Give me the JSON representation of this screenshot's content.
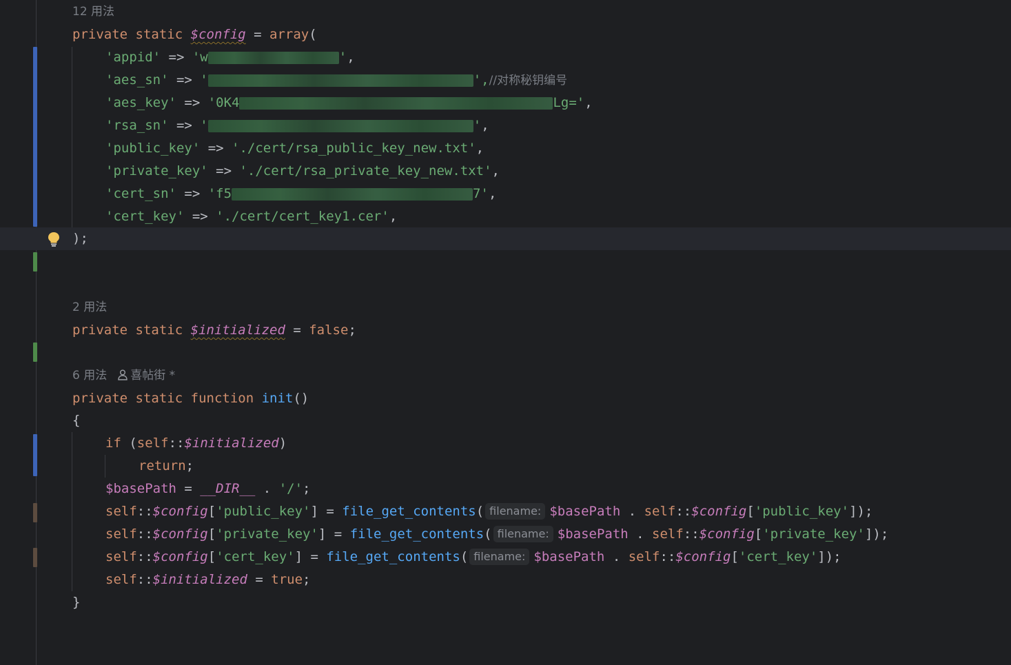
{
  "editor": {
    "usage_hints": {
      "config": "12 用法",
      "initialized": "2 用法",
      "init": "6 用法",
      "init_author": "喜帖街 *"
    },
    "tokens": {
      "private": "private",
      "static": "static",
      "function": "function",
      "config_var": "$config",
      "initialized_var": "$initialized",
      "assign": " = ",
      "array_kw": "array",
      "open_paren": "(",
      "close_paren_semi": ");",
      "false_kw": "false",
      "true_kw": "true",
      "semi": ";",
      "init_fn": "init",
      "empty_parens": "()",
      "open_brace": "{",
      "close_brace": "}",
      "if_kw": "if",
      "self": "self",
      "scope": "::",
      "return_kw": "return",
      "basepath_var": "$basePath",
      "dir_const": "__DIR__",
      "slash_str": "'/'",
      "fgc_fn": "file_get_contents",
      "filename_hint": "filename:",
      "concat": " . ",
      "arrow": " => ",
      "comma": ","
    },
    "config_entries": {
      "appid_key": "'appid'",
      "appid_val_prefix": "'w",
      "appid_val_suffix": "'",
      "aes_sn_key": "'aes_sn'",
      "aes_sn_val_prefix": "'",
      "aes_sn_val_suffix": "',",
      "aes_sn_comment": "//对称秘钥编号",
      "aes_key_key": "'aes_key'",
      "aes_key_val_prefix": "'0K4",
      "aes_key_val_suffix": "Lg='",
      "rsa_sn_key": "'rsa_sn'",
      "rsa_sn_val_prefix": "'",
      "rsa_sn_val_suffix": "'",
      "public_key_key": "'public_key'",
      "public_key_val": "'./cert/rsa_public_key_new.txt'",
      "private_key_key": "'private_key'",
      "private_key_val": "'./cert/rsa_private_key_new.txt'",
      "cert_sn_key": "'cert_sn'",
      "cert_sn_val_prefix": "'f5",
      "cert_sn_val_suffix": "7'",
      "cert_key_key": "'cert_key'",
      "cert_key_val": "'./cert/cert_key1.cer'"
    },
    "index_keys": {
      "public_key": "'public_key'",
      "private_key": "'private_key'",
      "cert_key": "'cert_key'"
    },
    "colors": {
      "background": "#1e1f22",
      "keyword": "#cf8e6d",
      "string": "#6aab73",
      "variable": "#c77dbb",
      "function": "#56a8f5",
      "comment": "#7a7e85",
      "text": "#bcbec4",
      "change_modified": "#3d64b8",
      "change_added": "#4e8a4a",
      "change_other": "#5c4b3f"
    },
    "icons": [
      "user-icon",
      "lightbulb-icon"
    ]
  }
}
